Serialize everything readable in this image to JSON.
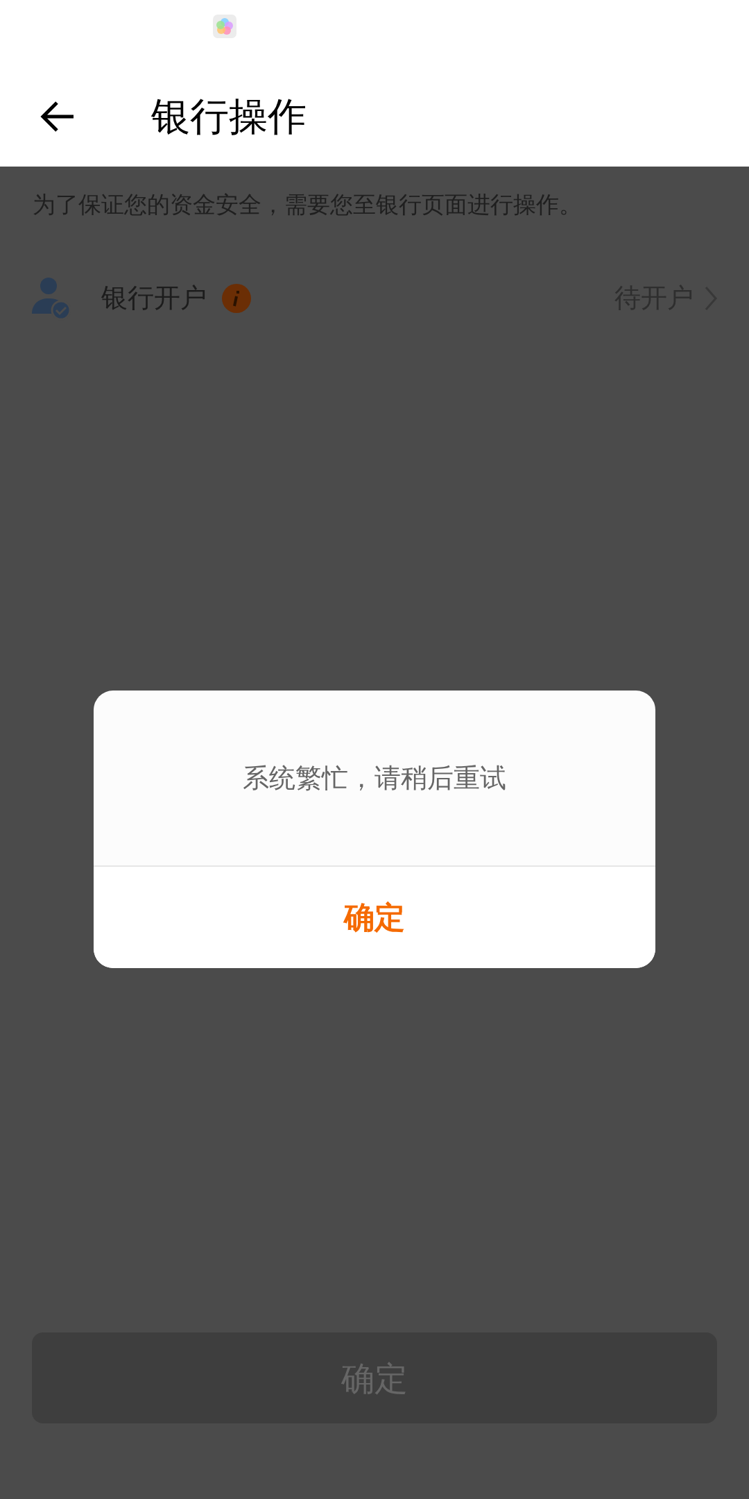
{
  "header": {
    "title": "银行操作"
  },
  "intro": "为了保证您的资金安全，需要您至银行页面进行操作。",
  "rows": [
    {
      "label": "银行开户",
      "status": "待开户"
    }
  ],
  "dialog": {
    "message": "系统繁忙，请稍后重试",
    "button": "确定"
  },
  "bottom_button": {
    "label": "确定",
    "disabled": true
  }
}
